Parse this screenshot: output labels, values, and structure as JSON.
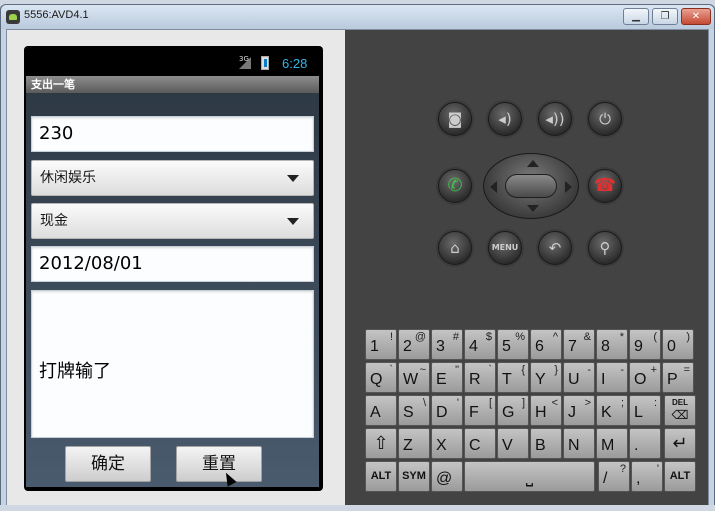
{
  "window": {
    "title": "5556:AVD4.1",
    "btn_min": "▁",
    "btn_max": "❐",
    "btn_close": "✕"
  },
  "status_bar": {
    "network": "3G",
    "time": "6:28"
  },
  "app": {
    "title": "支出一笔",
    "amount": "230",
    "category": "休闲娱乐",
    "account": "现金",
    "date": "2012/08/01",
    "note": "打牌输了",
    "confirm_label": "确定",
    "reset_label": "重置"
  },
  "controls": {
    "menu_label": "MENU"
  },
  "keyboard": {
    "row1": [
      {
        "m": "1",
        "s": "!"
      },
      {
        "m": "2",
        "s": "@"
      },
      {
        "m": "3",
        "s": "#"
      },
      {
        "m": "4",
        "s": "$"
      },
      {
        "m": "5",
        "s": "%"
      },
      {
        "m": "6",
        "s": "^"
      },
      {
        "m": "7",
        "s": "&"
      },
      {
        "m": "8",
        "s": "*"
      },
      {
        "m": "9",
        "s": "("
      },
      {
        "m": "0",
        "s": ")"
      }
    ],
    "row2": [
      {
        "m": "Q",
        "s": "`"
      },
      {
        "m": "W",
        "s": "~"
      },
      {
        "m": "E",
        "s": "\""
      },
      {
        "m": "R",
        "s": "`"
      },
      {
        "m": "T",
        "s": "{"
      },
      {
        "m": "Y",
        "s": "}"
      },
      {
        "m": "U",
        "s": "-"
      },
      {
        "m": "I",
        "s": "-"
      },
      {
        "m": "O",
        "s": "+"
      },
      {
        "m": "P",
        "s": "="
      }
    ],
    "row3": [
      {
        "m": "A",
        "s": ""
      },
      {
        "m": "S",
        "s": "\\"
      },
      {
        "m": "D",
        "s": "'"
      },
      {
        "m": "F",
        "s": "["
      },
      {
        "m": "G",
        "s": "]"
      },
      {
        "m": "H",
        "s": "<"
      },
      {
        "m": "J",
        "s": ">"
      },
      {
        "m": "K",
        "s": ";"
      },
      {
        "m": "L",
        "s": ":"
      }
    ],
    "del_label": "DEL",
    "row4": [
      {
        "m": "Z",
        "s": ""
      },
      {
        "m": "X",
        "s": ""
      },
      {
        "m": "C",
        "s": ""
      },
      {
        "m": "V",
        "s": ""
      },
      {
        "m": "B",
        "s": ""
      },
      {
        "m": "N",
        "s": ""
      },
      {
        "m": "M",
        "s": ""
      },
      {
        "m": ".",
        "s": ""
      }
    ],
    "alt_label": "ALT",
    "sym_label": "SYM",
    "at_label": "@",
    "slash_main": "/",
    "slash_sub": "?",
    "comma_main": ",",
    "comma_sub": "'"
  }
}
